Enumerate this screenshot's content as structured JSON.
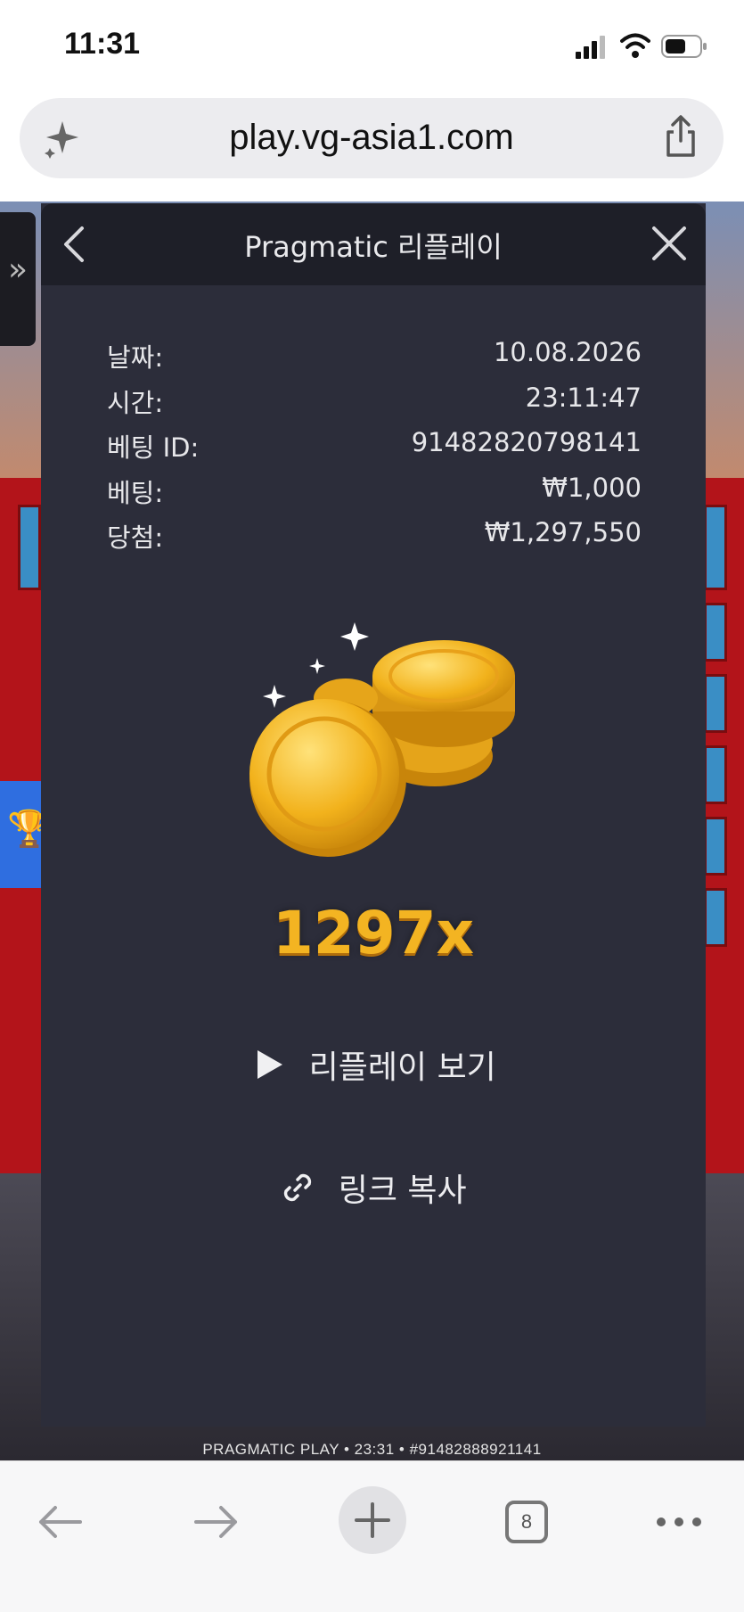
{
  "status_bar": {
    "time": "11:31"
  },
  "browser": {
    "url": "play.vg-asia1.com",
    "tab_count": "8"
  },
  "modal": {
    "title": "Pragmatic 리플레이",
    "details": [
      {
        "key": "날짜:",
        "value": "10.08.2026"
      },
      {
        "key": "시간:",
        "value": "23:11:47"
      },
      {
        "key": "베팅 ID:",
        "value": "91482820798141"
      },
      {
        "key": "베팅:",
        "value": "₩1,000"
      },
      {
        "key": "당첨:",
        "value": "₩1,297,550"
      }
    ],
    "multiplier": "1297x",
    "replay_label": "리플레이 보기",
    "copy_link_label": "링크 복사"
  },
  "game_footer": "PRAGMATIC PLAY • 23:31 • #91482888921141",
  "colors": {
    "modal_bg": "#2c2d3a",
    "header_bg": "#1e1f28",
    "multiplier": "#f3b422"
  }
}
